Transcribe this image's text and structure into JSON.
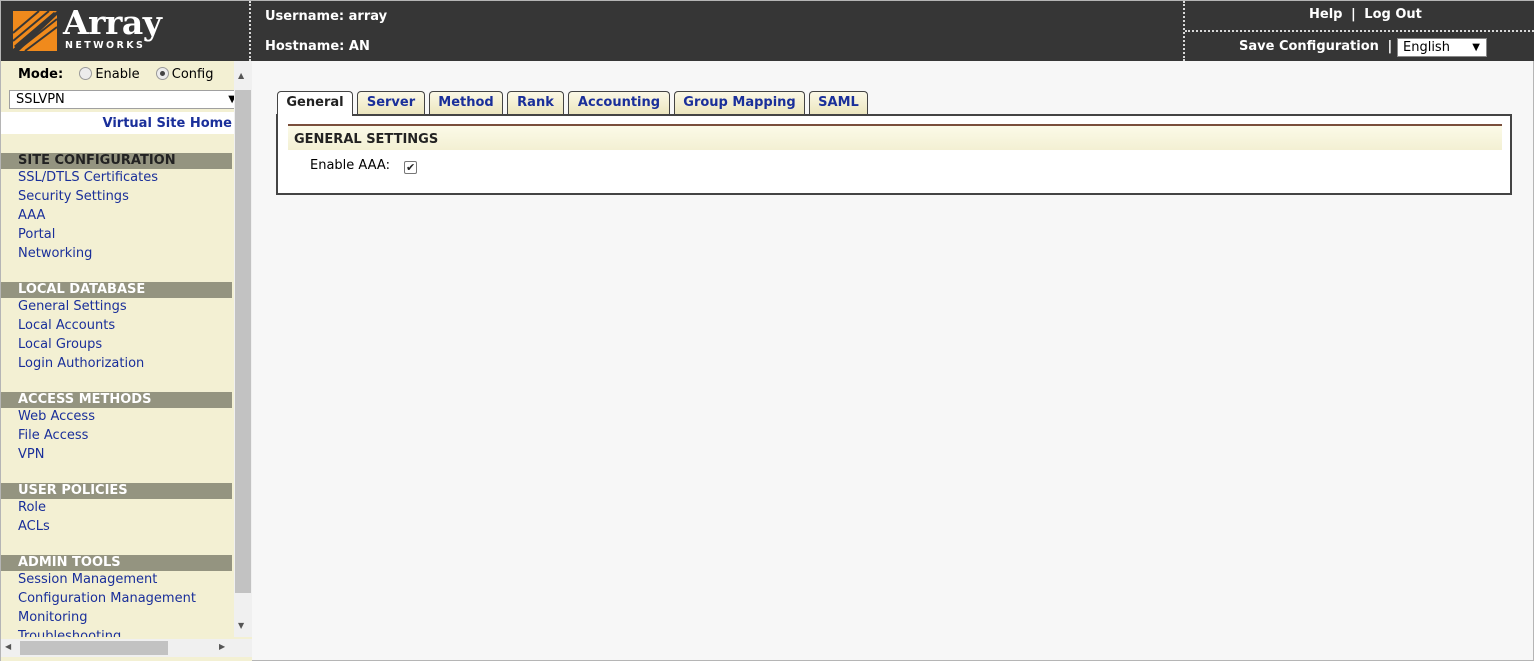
{
  "header": {
    "brand": "Array",
    "brand_sub": "NETWORKS",
    "username_label": "Username: array",
    "hostname_label": "Hostname: AN",
    "help": "Help",
    "sep": "|",
    "logout": "Log Out",
    "save_config": "Save Configuration",
    "language": "English"
  },
  "sidebar": {
    "mode_label": "Mode:",
    "mode_options": [
      {
        "label": "Enable",
        "checked": false
      },
      {
        "label": "Config",
        "checked": true
      }
    ],
    "site_select": "SSLVPN",
    "virtual_site_home": "Virtual Site Home",
    "sections": [
      {
        "title": "SITE CONFIGURATION",
        "items": [
          "SSL/DTLS Certificates",
          "Security Settings",
          "AAA",
          "Portal",
          "Networking"
        ]
      },
      {
        "title": "LOCAL DATABASE",
        "items": [
          "General Settings",
          "Local Accounts",
          "Local Groups",
          "Login Authorization"
        ]
      },
      {
        "title": "ACCESS METHODS",
        "items": [
          "Web Access",
          "File Access",
          "VPN"
        ]
      },
      {
        "title": "USER POLICIES",
        "items": [
          "Role",
          "ACLs"
        ]
      },
      {
        "title": "ADMIN TOOLS",
        "items": [
          "Session Management",
          "Configuration Management",
          "Monitoring",
          "Troubleshooting"
        ]
      }
    ]
  },
  "main": {
    "tabs": [
      {
        "label": "General",
        "active": true
      },
      {
        "label": "Server",
        "active": false
      },
      {
        "label": "Method",
        "active": false
      },
      {
        "label": "Rank",
        "active": false
      },
      {
        "label": "Accounting",
        "active": false
      },
      {
        "label": "Group Mapping",
        "active": false
      },
      {
        "label": "SAML",
        "active": false
      }
    ],
    "panel_title": "GENERAL SETTINGS",
    "enable_aaa_label": "Enable AAA:",
    "enable_aaa_checked": true
  },
  "colors": {
    "header_bg": "#363636",
    "sidebar_bg": "#f3f0d3",
    "section_bg": "#949480",
    "link": "#1a2f9a",
    "logo_orange": "#f08a1c"
  }
}
